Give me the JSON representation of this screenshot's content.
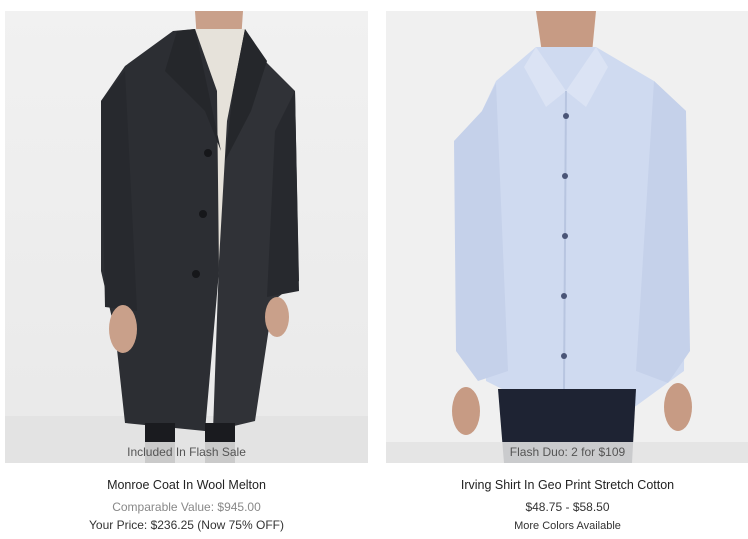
{
  "products": [
    {
      "name": "Monroe Coat In Wool Melton",
      "badge": "Included In Flash Sale",
      "comparable": "Comparable Value: $945.00",
      "your_price": "Your Price: $236.25 (Now 75% OFF)",
      "image_icon": "coat-photo"
    },
    {
      "name": "Irving Shirt In Geo Print Stretch Cotton",
      "badge": "Flash Duo: 2 for $109",
      "price_range": "$48.75 - $58.50",
      "more_colors": "More Colors Available",
      "image_icon": "shirt-photo"
    }
  ],
  "colors": {
    "background": "#ffffff",
    "badge_bg": "#e2e2e2",
    "muted_text": "#888888",
    "coat": "#2b2d31",
    "shirt": "#cdd8ef",
    "pants": "#1e2333"
  }
}
